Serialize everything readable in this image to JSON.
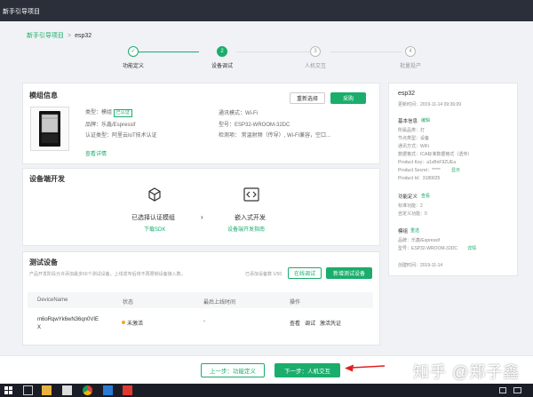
{
  "topbar": {
    "title": "新手引导项目"
  },
  "breadcrumb": {
    "parent": "新手引导项目",
    "separator": ">",
    "current": "esp32"
  },
  "steps": [
    {
      "number": "✓",
      "label": "功能定义",
      "state": "done"
    },
    {
      "number": "2",
      "label": "设备调试",
      "state": "active"
    },
    {
      "number": "3",
      "label": "人机交互",
      "state": "todo"
    },
    {
      "number": "4",
      "label": "批量投产",
      "state": "todo"
    }
  ],
  "module": {
    "title": "模组信息",
    "reselect": "重新选择",
    "buy": "采购",
    "type_label": "类型：模组",
    "certified": "已认证",
    "brand": "品牌：乐鑫/Espressif",
    "cert_type": "认证类型：阿里云IoT技术认证",
    "comm": "通讯模式：Wi-Fi",
    "model": "型号：ESP32-WROOM-32DC",
    "detect": "检测项：  常温射频（传导）, Wi-Fi兼容，空口...",
    "details": "查看详情"
  },
  "dev": {
    "title": "设备端开发",
    "selected_label": "已选择认证模组",
    "download_sdk": "下载SDK",
    "embedded_label": "嵌入式开发",
    "guide": "设备端开发指南"
  },
  "test": {
    "title": "测试设备",
    "desc": "产品开发阶段允许添加最多50个测试设备，上线发布后将不再限制设备接入数。",
    "count": "已添加设备数 1/50",
    "online_debug": "在线调试",
    "add_device": "新增测试设备",
    "columns": [
      "DeviceName",
      "状态",
      "最后上线时间",
      "操作"
    ],
    "row": {
      "name_line1": "m6oRqwYk6wN36qn0VIE",
      "name_line2": "X",
      "status": "未激活",
      "last_online": "-",
      "actions": [
        "查看",
        "调试",
        "激活凭证"
      ]
    }
  },
  "side": {
    "name": "esp32",
    "updated": "更新时间：2019-11-14 09:36:09",
    "basic_title": "基本信息",
    "edit": "编辑",
    "lines": [
      "所属品类：灯",
      "节点类型：设备",
      "通讯方式：WiFi",
      "数据格式：ICA标准数据格式（透传）",
      "Product Key：a1vBnF9ZUEa",
      "Product Secret：*****",
      "Product Id：3180025"
    ],
    "show": "显示",
    "func_title": "功能定义",
    "view": "查看",
    "func_lines": [
      "标准功能：2",
      "自定义功能：0"
    ],
    "module_title": "模组",
    "reselect": "重选",
    "module_lines": [
      "品牌：乐鑫/Espressif",
      "型号：ESP32-WROOM-32DC"
    ],
    "details": "详情",
    "created": "创建时间：2019-11-14"
  },
  "bottom": {
    "prev": "上一步：功能定义",
    "next": "下一步：人机交互"
  },
  "watermark": "知乎 @郑子鑫",
  "colors": {
    "accent": "#1aad6b",
    "arrow": "#e02020",
    "topbar": "#2b2f3a"
  }
}
